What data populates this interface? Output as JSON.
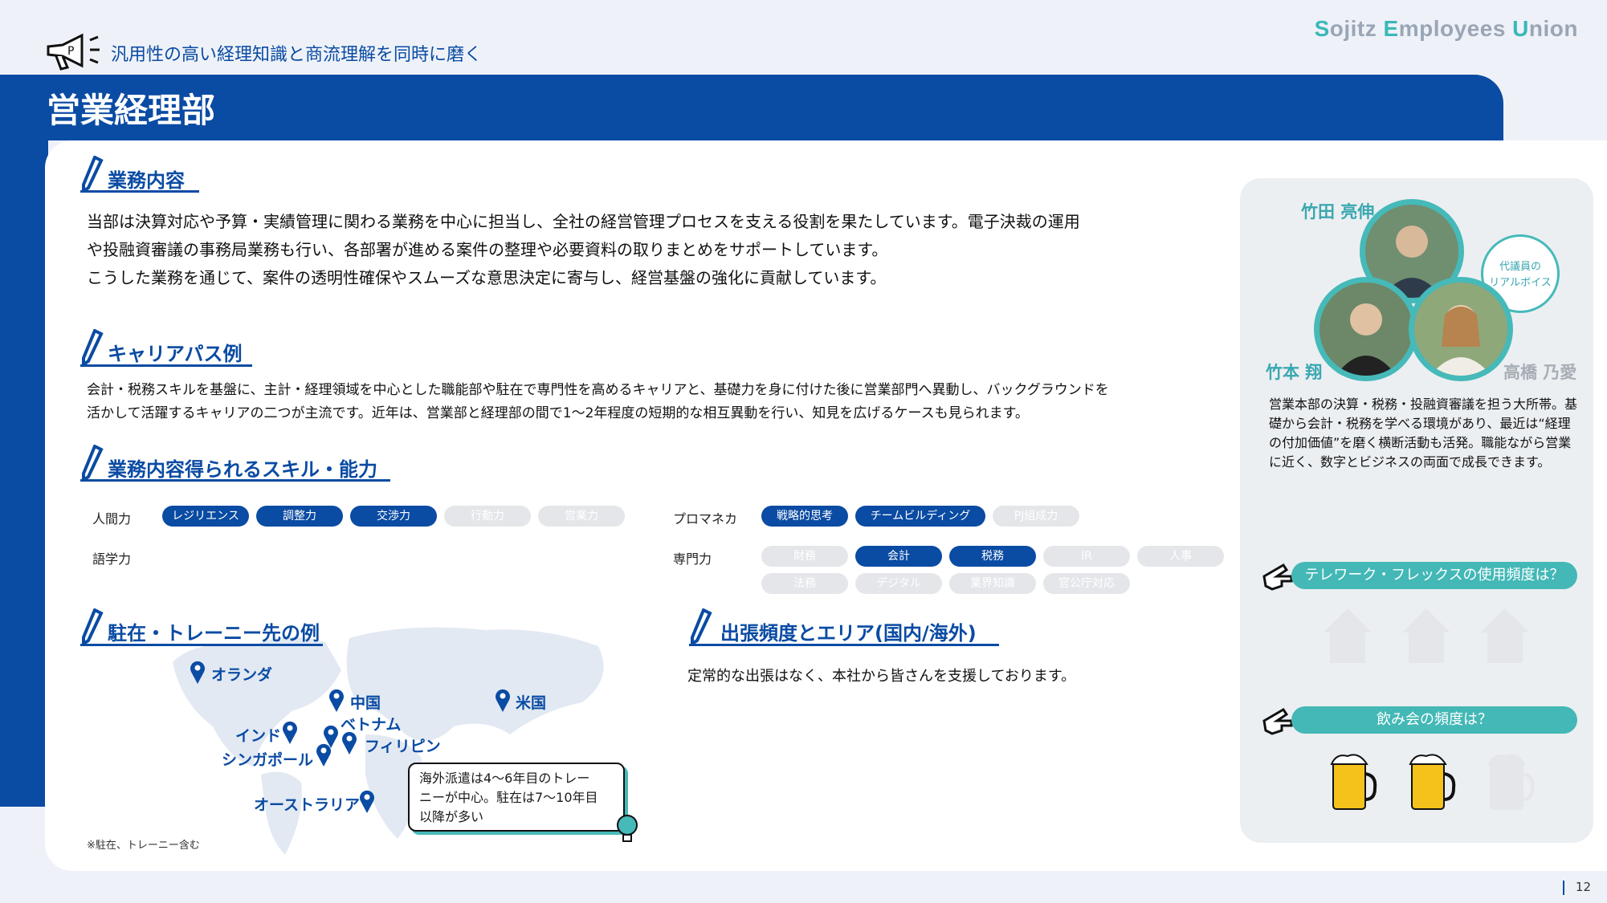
{
  "brand": {
    "s": "S",
    "w1": "ojitz ",
    "e": "E",
    "w2": "mployees ",
    "u": "U",
    "w3": "nion"
  },
  "header": {
    "subtitle": "汎用性の高い経理知識と商流理解を同時に磨く",
    "title": "営業経理部"
  },
  "sections": {
    "work": {
      "heading": "業務内容",
      "lines": [
        "当部は決算対応や予算・実績管理に関わる業務を中心に担当し、全社の経営管理プロセスを支える役割を果たしています。電子決裁の運用",
        "や投融資審議の事務局業務も行い、各部署が進める案件の整理や必要資料の取りまとめをサポートしています。",
        "こうした業務を通じて、案件の透明性確保やスムーズな意思決定に寄与し、経営基盤の強化に貢献しています。"
      ]
    },
    "career": {
      "heading": "キャリアパス例",
      "lines": [
        "会計・税務スキルを基盤に、主計・経理領域を中心とした職能部や駐在で専門性を高めるキャリアと、基礎力を身に付けた後に営業部門へ異動し、バックグラウンドを",
        "活かして活躍するキャリアの二つが主流です。近年は、営業部と経理部の間で1～2年程度の短期的な相互異動を行い、知見を広げるケースも見られます。"
      ]
    },
    "skills": {
      "heading": "業務内容得られるスキル・能力",
      "groups": {
        "human": {
          "label": "人間力",
          "items": [
            {
              "text": "レジリエンス",
              "on": true
            },
            {
              "text": "調整力",
              "on": true
            },
            {
              "text": "交渉力",
              "on": true
            },
            {
              "text": "行動力",
              "on": false
            },
            {
              "text": "営業力",
              "on": false
            }
          ]
        },
        "language": {
          "label": "語学力"
        },
        "pm": {
          "label": "プロマネカ",
          "items": [
            {
              "text": "戦略的思考",
              "on": true
            },
            {
              "text": "チームビルディング",
              "on": true
            },
            {
              "text": "PJ組成力",
              "on": false
            }
          ]
        },
        "expert": {
          "label": "専門力",
          "items": [
            {
              "text": "財務",
              "on": false
            },
            {
              "text": "会計",
              "on": true
            },
            {
              "text": "税務",
              "on": true
            },
            {
              "text": "IR",
              "on": false
            },
            {
              "text": "人事",
              "on": false
            },
            {
              "text": "法務",
              "on": false
            },
            {
              "text": "デジタル",
              "on": false
            },
            {
              "text": "業界知識",
              "on": false
            },
            {
              "text": "官公庁対応",
              "on": false
            }
          ]
        }
      }
    },
    "abroad": {
      "heading": "駐在・トレーニー先の例",
      "places": {
        "nl": "オランダ",
        "cn": "中国",
        "us": "米国",
        "in": "インド",
        "vn": "ベトナム",
        "ph": "フィリピン",
        "sg": "シンガポール",
        "au": "オーストラリア"
      },
      "callout": [
        "海外派遣は4～6年目のトレー",
        "ニーが中心。駐在は7～10年目",
        "以降が多い"
      ],
      "note": "※駐在、トレーニー含む"
    },
    "travel": {
      "heading": "出張頻度とエリア(国内/海外)",
      "text": "定常的な出張はなく、本社から皆さんを支援しております。"
    }
  },
  "panel": {
    "names": {
      "takeda": "竹田 亮伸",
      "takemoto": "竹本 翔",
      "takahashi": "高橋 乃愛"
    },
    "bubble": [
      "代議員の",
      "リアルボイス"
    ],
    "lines": [
      "営業本部の決算・税務・投融資審議を担う大所帯。基",
      "礎から会計・税務を学べる環境があり、最近は“経理",
      "の付加価値”を磨く横断活動も活発。職能ながら営業",
      "に近く、数字とビジネスの両面で成長できます。"
    ],
    "q1": "テレワーク・フレックスの使用頻度は？",
    "q1_value": {
      "active": 0,
      "total": 3
    },
    "q2": "飲み会の頻度は？",
    "q2_value": {
      "active": 2,
      "total": 3
    }
  },
  "page_number": "12",
  "colors": {
    "brand_blue": "#0a4ba3",
    "teal": "#46b9b9",
    "inactive": "#e4e6ea"
  }
}
